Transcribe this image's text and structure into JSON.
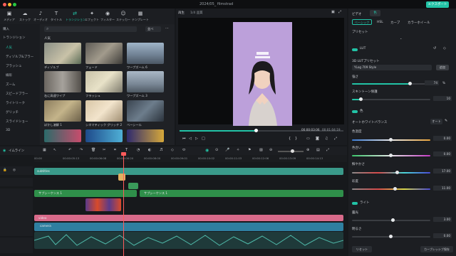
{
  "window": {
    "title": "2024/05_ filmstrad",
    "export_label": "エクスポート"
  },
  "toolbar": {
    "tools": [
      {
        "icon": "media-icon",
        "label": "メディア"
      },
      {
        "icon": "stock-icon",
        "label": "ストック"
      },
      {
        "icon": "audio-icon",
        "label": "オーディオ"
      },
      {
        "icon": "title-icon",
        "label": "タイトル"
      },
      {
        "icon": "transition-icon",
        "label": "トランジション"
      },
      {
        "icon": "effect-icon",
        "label": "エフェクト"
      },
      {
        "icon": "filter-icon",
        "label": "フィルター"
      },
      {
        "icon": "sticker-icon",
        "label": "ステッカー"
      },
      {
        "icon": "template-icon",
        "label": "テンプレート"
      }
    ]
  },
  "sidebar": {
    "items": [
      "購入",
      "トランジション",
      "人気",
      "ディゾルブ&ブラー",
      "ブラッシュ",
      "線形",
      "ズーム",
      "スピードブラー",
      "ライトリーク",
      "グリッチ",
      "スライドショー",
      "3D"
    ]
  },
  "browser": {
    "section_label": "人気",
    "sort_label": "並べ",
    "items": [
      "ディゾルブ",
      "フェード",
      "ワープズーム 6",
      "右に高速ワイプ",
      "フラッシュ",
      "ワープズーム 3",
      "ぼかし溶解 1",
      "シネマティック グリッチ 2",
      "ベーシール"
    ]
  },
  "preview": {
    "tab_label": "再生",
    "quality_label": "1/4 品質",
    "current_time": "00:00:03:06",
    "total_time": "00:01:04:19"
  },
  "right_panel": {
    "tabs": [
      "ビデオ",
      "色"
    ],
    "subtabs": [
      "ベーシック",
      "HSL",
      "カーブ",
      "カラーホイール"
    ],
    "preset_label": "プリセット",
    "lut_label": "LUT",
    "lut_3d_label": "3D LUTプリセット",
    "lut_value": "YLog 709 Style",
    "lut_apply": "追加",
    "strength_label": "強さ",
    "strength_value": "74",
    "strength_unit": "%",
    "skin_protect_label": "スキントーン保護",
    "skin_protect_value": "10",
    "color_label": "色",
    "white_balance_label": "オートホワイトバランス",
    "white_balance_btn": "オート",
    "temp_label": "色温度",
    "temp_value": "0.00",
    "tint_label": "色合い",
    "tint_value": "0.00",
    "vibrance_label": "鮮やかさ",
    "vibrance_value": "17.00",
    "saturation_label": "彩度",
    "saturation_value": "11.00",
    "light_label": "ライト",
    "exposure_label": "露光",
    "exposure_value": "3.00",
    "brightness_label": "明るさ",
    "brightness_value": "0.00",
    "reset_label": "リセット",
    "save_custom_label": "カーブレッシブ保存"
  },
  "timeline": {
    "label": "イムライン",
    "timecodes": [
      "00:00",
      "00:00:05:13",
      "00:00:06:08",
      "00:00:06:20",
      "00:00:08:00",
      "00:00:09:01",
      "00:00:10:02",
      "00:00:11:03",
      "00:00:12:06",
      "00:00:13:09",
      "00:00:14:13",
      "00:00:15:02"
    ],
    "clips": {
      "subtitles": "subtitles",
      "seq1": "サブシーケンス 1",
      "seq1b": "サブシーケンス 1",
      "video": "video",
      "audio": "camera"
    }
  }
}
